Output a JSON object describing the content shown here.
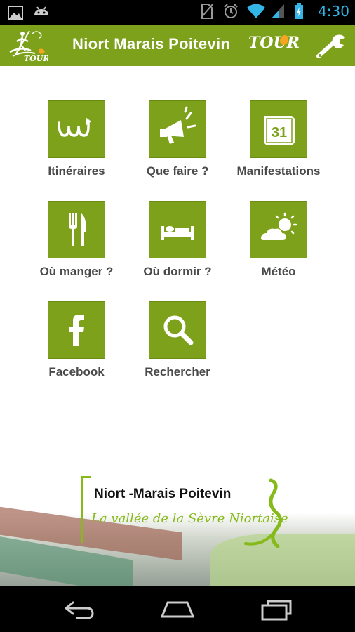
{
  "status_bar": {
    "time": "4:30",
    "icons": [
      "image-icon",
      "android-icon",
      "no-sim-icon",
      "alarm-icon",
      "wifi-icon",
      "signal-icon",
      "battery-icon"
    ]
  },
  "action_bar": {
    "title": "Niort Marais Poitevin",
    "tour_badge": "TOUR",
    "logo_badge": "TOUR",
    "accent_color": "#7da11a"
  },
  "menu": [
    {
      "label": "Itinéraires",
      "icon": "route-icon"
    },
    {
      "label": "Que faire ?",
      "icon": "megaphone-icon"
    },
    {
      "label": "Manifestations",
      "icon": "calendar-icon",
      "calendar_day": "31"
    },
    {
      "label": "Où manger ?",
      "icon": "fork-knife-icon"
    },
    {
      "label": "Où dormir ?",
      "icon": "bed-icon"
    },
    {
      "label": "Météo",
      "icon": "weather-icon"
    },
    {
      "label": "Facebook",
      "icon": "facebook-icon"
    },
    {
      "label": "Rechercher",
      "icon": "search-icon"
    }
  ],
  "footer": {
    "brand_name": "Niort -Marais Poitevin",
    "tagline": "La vallée de la Sèvre Niortaise"
  },
  "nav_bar": {
    "buttons": [
      "back-icon",
      "home-icon",
      "recents-icon"
    ]
  }
}
